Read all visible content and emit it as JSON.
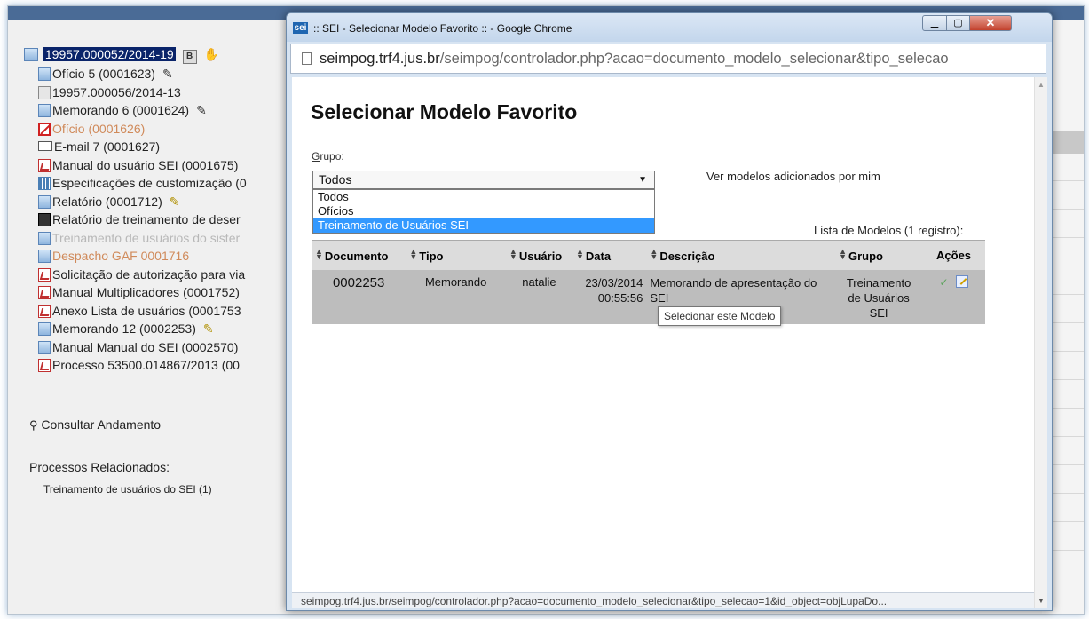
{
  "background": {
    "process": {
      "number": "19957.000052/2014-19",
      "badge": "B",
      "children": [
        {
          "label": "Ofício 5 (0001623)",
          "icon": "doc-blue",
          "mark": "pen"
        },
        {
          "label": "19957.000056/2014-13",
          "icon": "doc-gray",
          "mark": ""
        },
        {
          "label": "Memorando 6 (0001624)",
          "icon": "doc-blue",
          "mark": "pen"
        },
        {
          "label": "Ofício (0001626)",
          "icon": "cancel",
          "mark": "",
          "style": "muted"
        },
        {
          "label": "E-mail 7 (0001627)",
          "icon": "mail",
          "mark": ""
        },
        {
          "label": "Manual do usuário SEI (0001675)",
          "icon": "pdf",
          "mark": ""
        },
        {
          "label": "Especificações de customização (0",
          "icon": "grid-ic",
          "mark": ""
        },
        {
          "label": "Relatório (0001712)",
          "icon": "doc-blue",
          "mark": "pen-y"
        },
        {
          "label": "Relatório de treinamento de deser",
          "icon": "dark-ic",
          "mark": ""
        },
        {
          "label": "Treinamento de usuários do sister",
          "icon": "doc-blue",
          "mark": "",
          "style": "muted2"
        },
        {
          "label": "Despacho GAF 0001716",
          "icon": "doc-blue",
          "mark": "",
          "style": "muted"
        },
        {
          "label": "Solicitação de autorização para via",
          "icon": "pdf",
          "mark": ""
        },
        {
          "label": "Manual Multiplicadores (0001752)",
          "icon": "pdf",
          "mark": ""
        },
        {
          "label": "Anexo Lista de usuários (0001753",
          "icon": "pdf",
          "mark": ""
        },
        {
          "label": "Memorando 12 (0002253)",
          "icon": "doc-blue",
          "mark": "pen-y"
        },
        {
          "label": "Manual Manual do SEI (0002570)",
          "icon": "doc-blue",
          "mark": ""
        },
        {
          "label": "Processo 53500.014867/2013 (00",
          "icon": "pdf",
          "mark": ""
        }
      ]
    },
    "consultar_andamento": "Consultar Andamento",
    "processos_relacionados": "Processos Relacionados:",
    "processo_relacionado_item": "Treinamento de usuários do SEI (1)"
  },
  "popup": {
    "favicon": "sei",
    "window_title": ":: SEI - Selecionar Modelo Favorito :: - Google Chrome",
    "url_host": "seimpog.trf4.jus.br",
    "url_rest": "/seimpog/controlador.php?acao=documento_modelo_selecionar&tipo_selecao",
    "status_url": "seimpog.trf4.jus.br/seimpog/controlador.php?acao=documento_modelo_selecionar&tipo_selecao=1&id_object=objLupaDo...",
    "page_title": "Selecionar Modelo Favorito",
    "grupo_label_first": "G",
    "grupo_label_rest": "rupo:",
    "grupo_selected": "Todos",
    "grupo_options": [
      {
        "label": "Todos",
        "selected": false
      },
      {
        "label": "Ofícios",
        "selected": false
      },
      {
        "label": "Treinamento de Usuários SEI",
        "selected": true
      }
    ],
    "ver_modelos_link": "Ver modelos adicionados por mim",
    "lista_caption": "Lista de Modelos (1 registro):",
    "table": {
      "headers": [
        "Documento",
        "Tipo",
        "Usuário",
        "Data",
        "Descrição",
        "Grupo",
        "Ações"
      ],
      "rows": [
        {
          "documento": "0002253",
          "tipo": "Memorando",
          "usuario": "natalie",
          "data_dia": "23/03/2014",
          "data_hora": "00:55:56",
          "descricao": "Memorando de apresentação do SEI",
          "grupo": "Treinamento de Usuários SEI"
        }
      ]
    },
    "tooltip": "Selecionar este Modelo",
    "colors": {
      "selected_option": "#3399ff",
      "table_header": "#dcdcdc",
      "table_row": "#bdbdbd"
    }
  }
}
